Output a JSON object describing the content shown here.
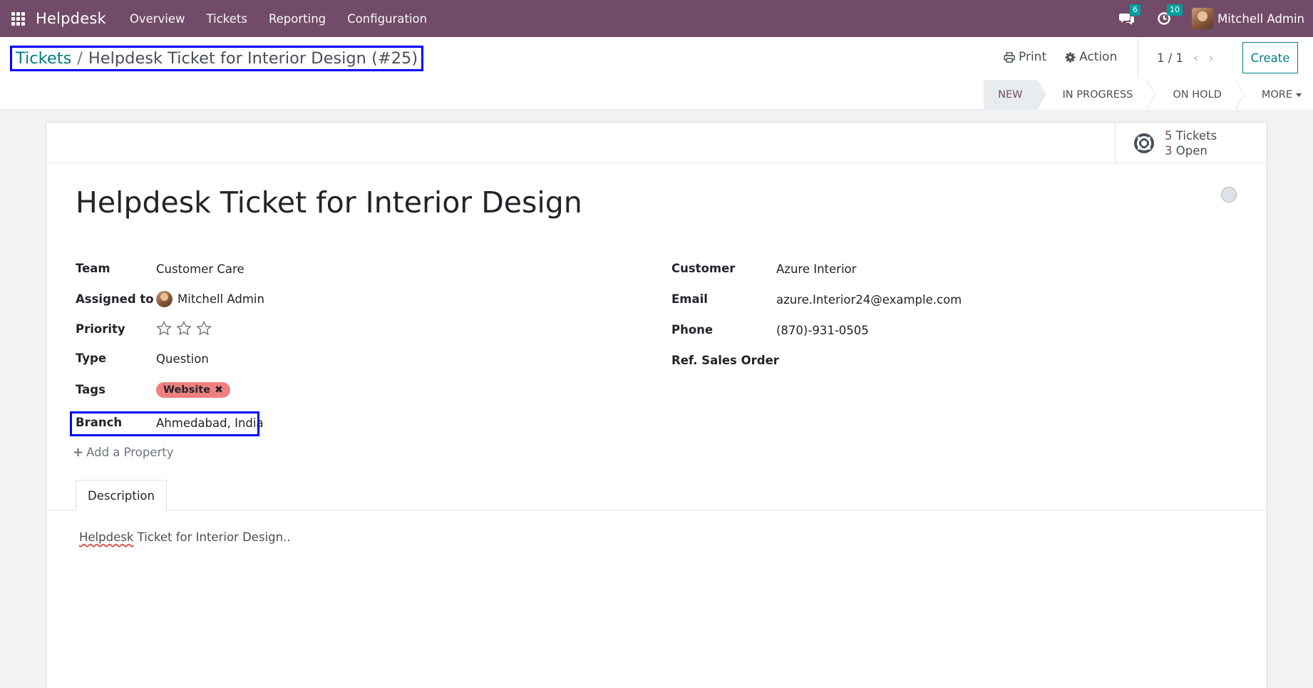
{
  "navbar": {
    "app_name": "Helpdesk",
    "menu": [
      "Overview",
      "Tickets",
      "Reporting",
      "Configuration"
    ],
    "messages_count": "6",
    "activities_count": "10",
    "user_name": "Mitchell Admin"
  },
  "control_panel": {
    "breadcrumb_parent": "Tickets",
    "breadcrumb_separator": "/",
    "breadcrumb_current": "Helpdesk Ticket for Interior Design (#25)",
    "print_label": "Print",
    "action_label": "Action",
    "pager": "1 / 1",
    "create_label": "Create",
    "stages": [
      "NEW",
      "IN PROGRESS",
      "ON HOLD"
    ],
    "active_stage": "NEW",
    "more_label": "MORE"
  },
  "smart_button": {
    "tickets_count": "5",
    "tickets_label": "Tickets",
    "open_count": "3",
    "open_label": "Open"
  },
  "ticket": {
    "title": "Helpdesk Ticket for Interior Design",
    "left_fields": {
      "team_label": "Team",
      "team_value": "Customer Care",
      "assigned_label": "Assigned to",
      "assigned_value": "Mitchell Admin",
      "priority_label": "Priority",
      "priority_stars": 0,
      "type_label": "Type",
      "type_value": "Question",
      "tags_label": "Tags",
      "tag_value": "Website",
      "branch_label": "Branch",
      "branch_value": "Ahmedabad, India"
    },
    "right_fields": {
      "customer_label": "Customer",
      "customer_value": "Azure Interior",
      "email_label": "Email",
      "email_value": "azure.Interior24@example.com",
      "phone_label": "Phone",
      "phone_value": "(870)-931-0505",
      "sales_order_label": "Ref. Sales Order",
      "sales_order_value": ""
    },
    "add_property_label": "Add a Property",
    "tab_label": "Description",
    "description_first_word": "Helpdesk",
    "description_rest": " Ticket for Interior Design.."
  },
  "colors": {
    "navbar": "#714b67",
    "accent": "#017e84",
    "tag": "#f0807f",
    "highlight_box": "#0000ff"
  }
}
